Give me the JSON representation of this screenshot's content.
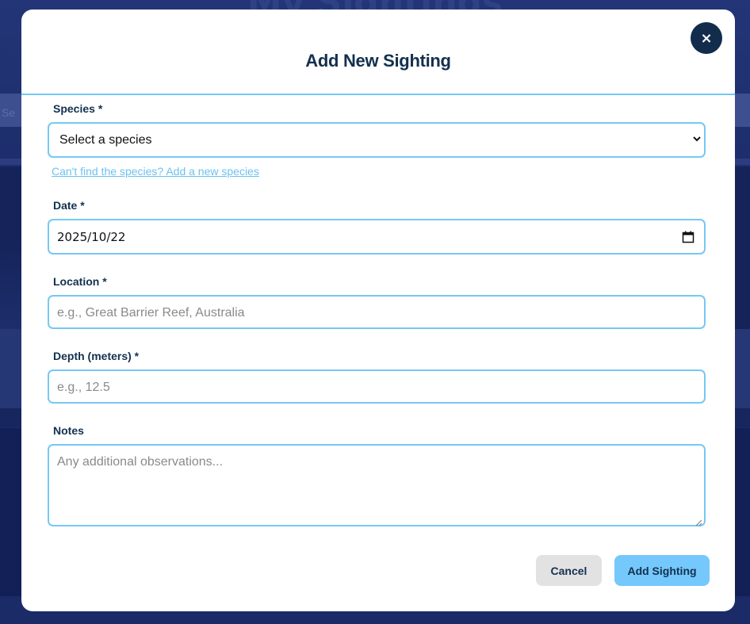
{
  "background": {
    "page_title": "My Sightings",
    "search_hint": "Se"
  },
  "modal": {
    "title": "Add New Sighting",
    "close_label": "×",
    "species": {
      "label": "Species *",
      "selected": "Select a species",
      "add_link": "Can't find the species? Add a new species"
    },
    "date": {
      "label": "Date *",
      "value": "2025/10/22"
    },
    "location": {
      "label": "Location *",
      "placeholder": "e.g., Great Barrier Reef, Australia"
    },
    "depth": {
      "label": "Depth (meters) *",
      "placeholder": "e.g., 12.5"
    },
    "notes": {
      "label": "Notes",
      "placeholder": "Any additional observations..."
    },
    "buttons": {
      "cancel": "Cancel",
      "submit": "Add Sighting"
    }
  },
  "colors": {
    "navy": "#13304f",
    "accent": "#74c8fb",
    "border": "#76c8f3",
    "cancel_bg": "#e2e2e2",
    "link": "#6cc2f0"
  },
  "icons": {
    "close": "close-icon",
    "dropdown": "chevron-down-icon",
    "date": "calendar-icon",
    "resize": "resize-grip-icon"
  }
}
